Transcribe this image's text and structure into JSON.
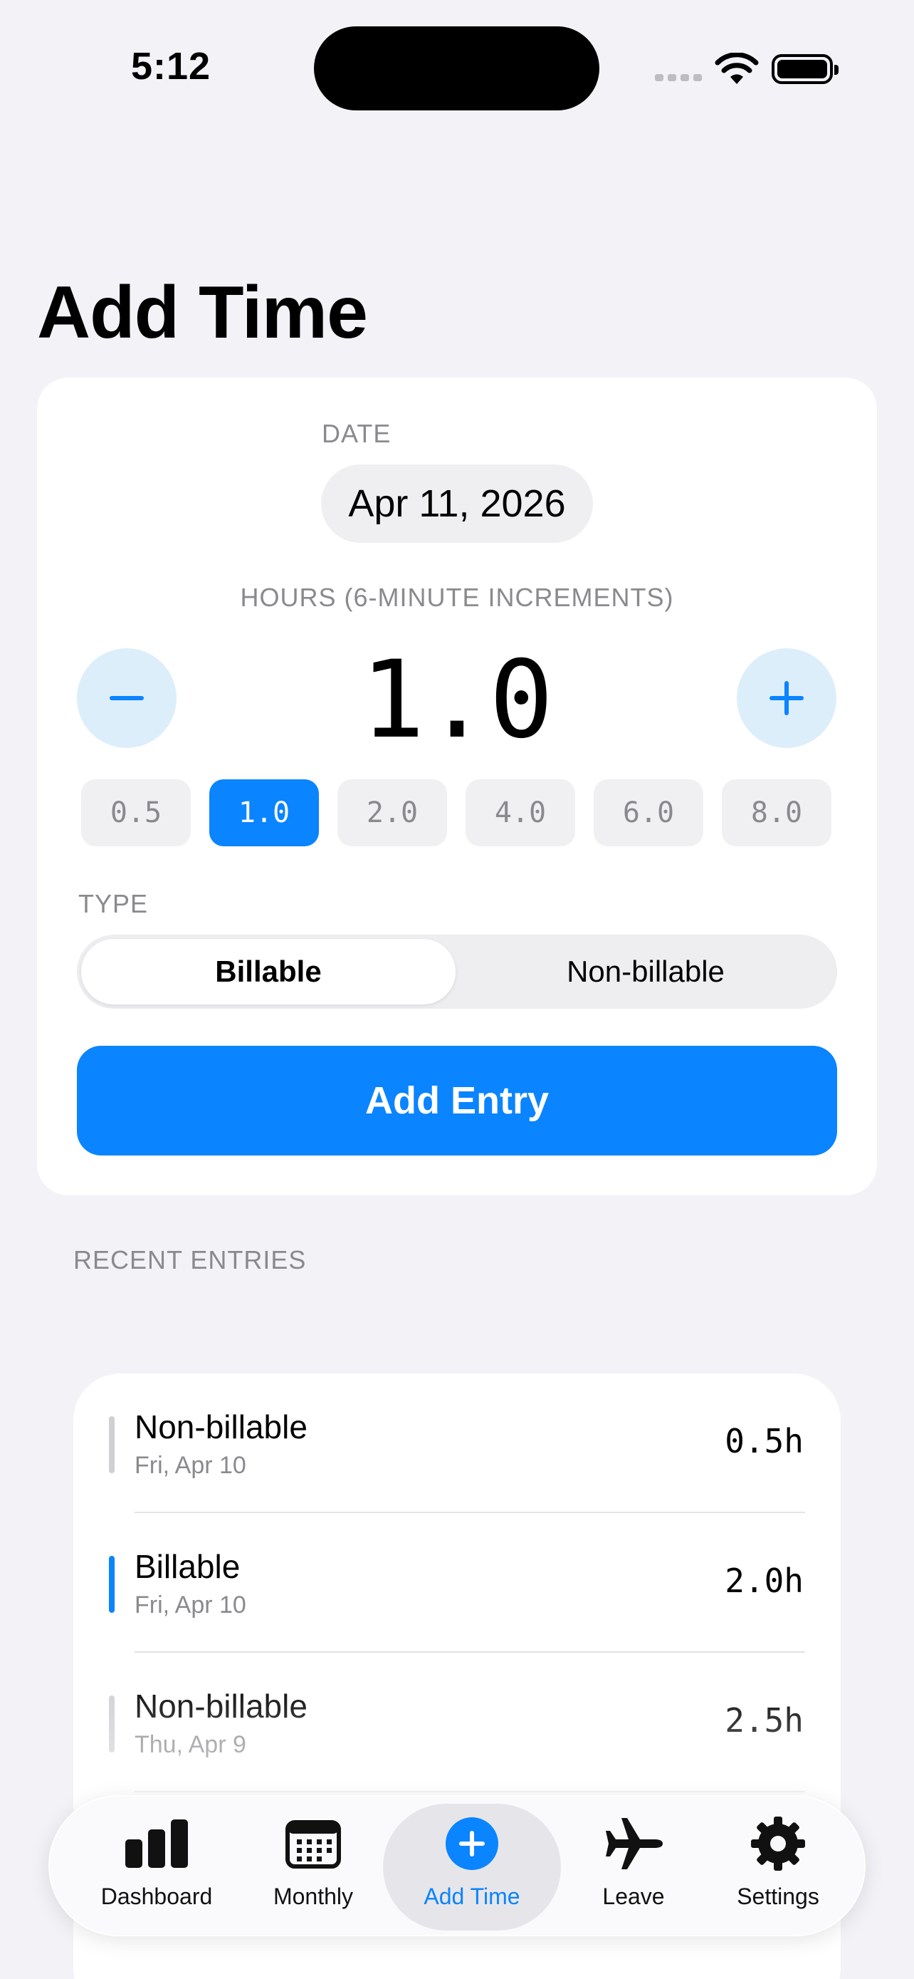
{
  "status_bar": {
    "time": "5:12"
  },
  "page": {
    "title": "Add Time"
  },
  "form": {
    "date_label": "DATE",
    "date_value": "Apr 11, 2026",
    "hours_label": "HOURS (6-MINUTE INCREMENTS)",
    "hours_value": "1.0",
    "presets": [
      "0.5",
      "1.0",
      "2.0",
      "4.0",
      "6.0",
      "8.0"
    ],
    "selected_preset": "1.0",
    "type_label": "TYPE",
    "type_options": [
      "Billable",
      "Non-billable"
    ],
    "selected_type": "Billable",
    "add_button": "Add Entry"
  },
  "recent": {
    "label": "RECENT ENTRIES",
    "entries": [
      {
        "type": "Non-billable",
        "date": "Fri, Apr 10",
        "hours": "0.5h"
      },
      {
        "type": "Billable",
        "date": "Fri, Apr 10",
        "hours": "2.0h"
      },
      {
        "type": "Non-billable",
        "date": "Thu, Apr 9",
        "hours": "2.5h"
      }
    ]
  },
  "tabbar": {
    "tabs": [
      {
        "label": "Dashboard",
        "icon": "chart-bar-icon"
      },
      {
        "label": "Monthly",
        "icon": "calendar-icon"
      },
      {
        "label": "Add Time",
        "icon": "plus-circle-icon"
      },
      {
        "label": "Leave",
        "icon": "airplane-icon"
      },
      {
        "label": "Settings",
        "icon": "gear-icon"
      }
    ],
    "selected": "Add Time"
  },
  "colors": {
    "accent": "#0A84FF",
    "background": "#F2F2F7",
    "inactive_indicator": "#CFCFD4"
  }
}
